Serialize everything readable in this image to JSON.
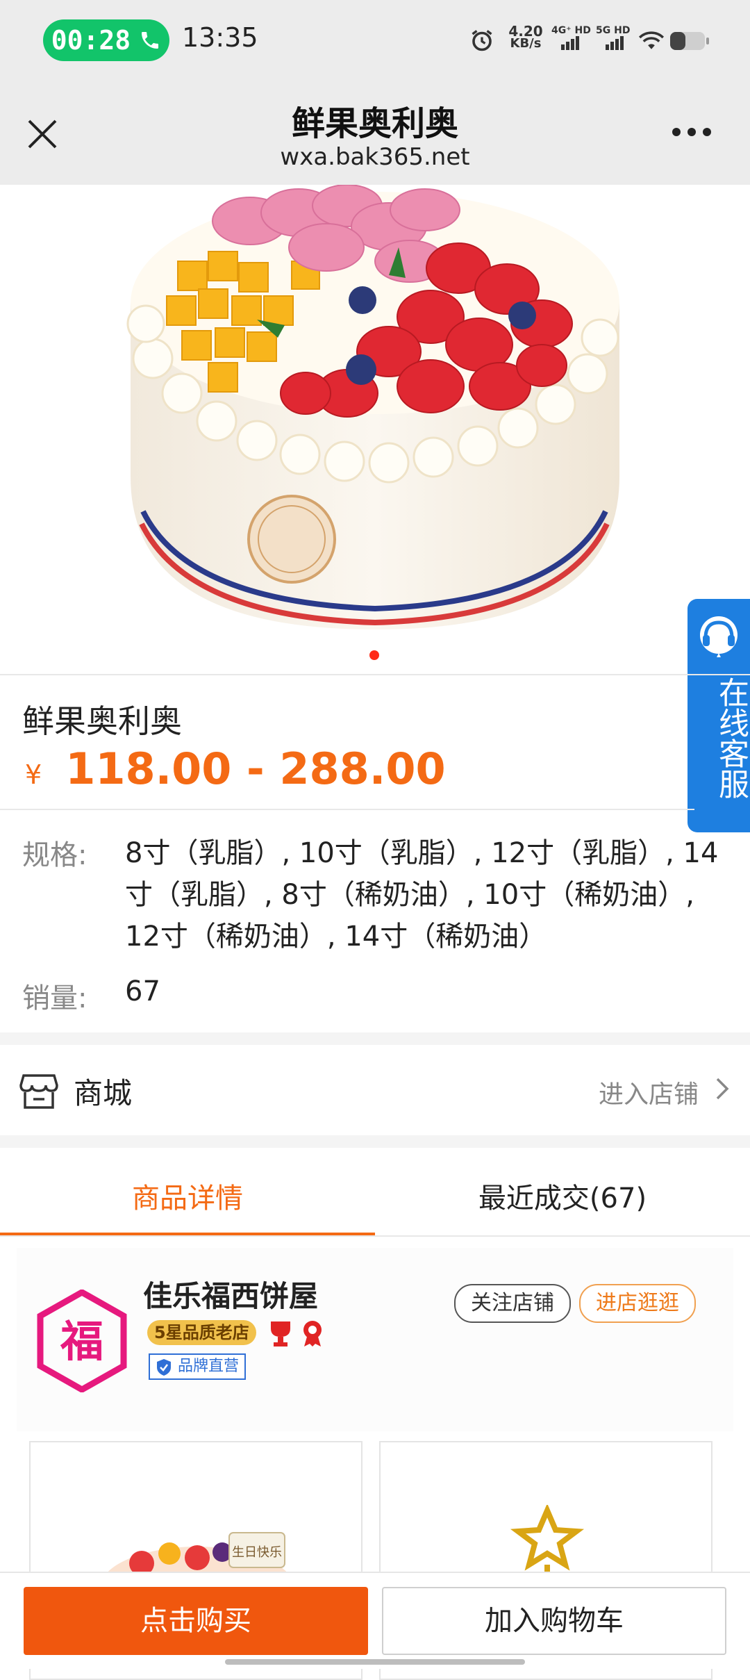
{
  "status_bar": {
    "call_timer": "00:28",
    "time": "13:35",
    "net_speed_value": "4.20",
    "net_speed_unit": "KB/s",
    "sim1_label": "4G⁺ HD",
    "sim2_label": "5G HD",
    "icons": [
      "phone-icon",
      "alarm-icon",
      "signal-icon",
      "wifi-icon",
      "battery-icon"
    ]
  },
  "title_bar": {
    "title": "鲜果奥利奥",
    "url": "wxa.bak365.net",
    "close_icon": "close-icon",
    "more_icon": "more-icon"
  },
  "carousel": {
    "active_index": 0,
    "count": 1
  },
  "service": {
    "label": "在线客服",
    "icon": "headset-icon"
  },
  "product": {
    "name": "鲜果奥利奥",
    "currency": "¥",
    "price_range": "118.00 - 288.00",
    "spec_label": "规格:",
    "spec_value": "8寸（乳脂）, 10寸（乳脂）, 12寸（乳脂）, 14寸（乳脂）, 8寸（稀奶油）, 10寸（稀奶油）, 12寸（稀奶油）, 14寸（稀奶油）",
    "sales_label": "销量:",
    "sales_value": "67"
  },
  "store_row": {
    "name": "商城",
    "enter_label": "进入店铺",
    "icon": "store-icon"
  },
  "tabs": [
    {
      "label": "商品详情",
      "active": true
    },
    {
      "label": "最近成交(67)",
      "active": false
    }
  ],
  "shop_banner": {
    "shop_name": "佳乐福西饼屋",
    "star_badge": "5星品质老店",
    "brand_badge": "品牌直营",
    "follow_label": "关注店铺",
    "visit_label": "进店逛逛",
    "logo_char": "福",
    "cake_topper_text": "生日快乐"
  },
  "bottom_bar": {
    "buy_label": "点击购买",
    "cart_label": "加入购物车"
  },
  "colors": {
    "accent": "#f46a14",
    "buy_button": "#f0570e",
    "service_blue": "#1e7fe0",
    "call_green": "#12c46a"
  }
}
